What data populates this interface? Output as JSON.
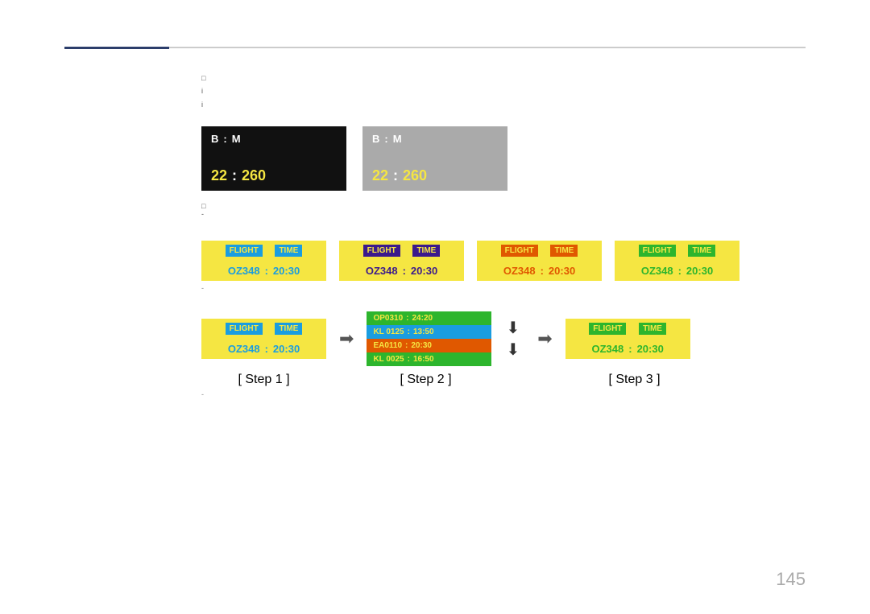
{
  "page": {
    "number": "145",
    "accent_color": "#2c3e6b",
    "line_color": "#cccccc"
  },
  "bullets_top": {
    "icon": "□",
    "items": [
      "i",
      "i"
    ]
  },
  "display_boxes": [
    {
      "type": "dark",
      "top_label1": "B",
      "colon1": ":",
      "top_label2": "M",
      "bottom_label1": "22",
      "colon2": ":",
      "bottom_label2": "260"
    },
    {
      "type": "grey",
      "top_label1": "B",
      "colon1": ":",
      "top_label2": "M",
      "bottom_label1": "22",
      "colon2": ":",
      "bottom_label2": "260"
    }
  ],
  "bullets_middle": {
    "icon": "□",
    "dash": "-"
  },
  "flight_cards": [
    {
      "id": "card1",
      "variant": "yellow-blue",
      "header_flight": "FLIGHT",
      "header_time": "TIME",
      "data_flight": "OZ348",
      "data_time": "20:30"
    },
    {
      "id": "card2",
      "variant": "yellow-purple",
      "header_flight": "FLIGHT",
      "header_time": "TIME",
      "data_flight": "OZ348",
      "data_time": "20:30"
    },
    {
      "id": "card3",
      "variant": "yellow-orange",
      "header_flight": "FLIGHT",
      "header_time": "TIME",
      "data_flight": "OZ348",
      "data_time": "20:30"
    },
    {
      "id": "card4",
      "variant": "yellow-green",
      "header_flight": "FLIGHT",
      "header_time": "TIME",
      "data_flight": "OZ348",
      "data_time": "20:30"
    }
  ],
  "dash_label": "-",
  "steps": {
    "step1": {
      "label": "[ Step 1 ]",
      "header_flight": "FLIGHT",
      "header_time": "TIME",
      "data_flight": "OZ348",
      "data_time": "20:30"
    },
    "step2": {
      "label": "[ Step 2 ]",
      "flights": [
        {
          "code": "OP0310",
          "time": "24:20",
          "color": "green"
        },
        {
          "code": "KL 0125",
          "time": "13:50",
          "color": "blue"
        },
        {
          "code": "EA0110",
          "time": "20:30",
          "color": "orange"
        },
        {
          "code": "KL 0025",
          "time": "16:50",
          "color": "green2"
        }
      ]
    },
    "step3": {
      "label": "[ Step 3 ]",
      "header_flight": "FLIGHT",
      "header_time": "TIME",
      "data_flight": "OZ348",
      "data_time": "20:30"
    }
  },
  "small_dash_bottom": "-"
}
